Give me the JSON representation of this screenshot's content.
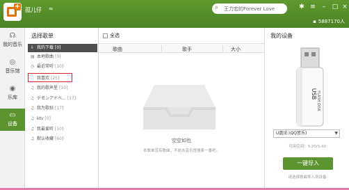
{
  "app": {
    "username": "孤儿仔",
    "search_placeholder": "王力宏的Forever Love",
    "online_count": "5887170人",
    "colors": {
      "brand_green": "#4a8323",
      "active_green": "#5c9430",
      "highlight_red": "#d9262c",
      "logo_orange": "#e57200"
    }
  },
  "nav": {
    "items": [
      {
        "label": "我的音乐",
        "icon": "headphones-icon"
      },
      {
        "label": "音乐馆",
        "icon": "music-hall-icon"
      },
      {
        "label": "乐库",
        "icon": "disc-icon"
      },
      {
        "label": "设备",
        "icon": "device-icon"
      }
    ]
  },
  "playlist": {
    "title": "选择歌单",
    "items": [
      {
        "label": "我的下载",
        "count": "[0]",
        "icon": "download-icon"
      },
      {
        "label": "本地歌曲",
        "count": "[0]",
        "icon": "local-music-icon"
      },
      {
        "label": "最近常听",
        "count": "[10]",
        "icon": "clock-icon"
      },
      {
        "label": "我喜欢",
        "count": "[25]",
        "icon": "heart-icon"
      },
      {
        "label": "我的歌声里",
        "count": "[10]",
        "icon": "playlist-icon"
      },
      {
        "label": "デモンアドベ...",
        "count": "[17]",
        "icon": "playlist-icon"
      },
      {
        "label": "我为歌狂",
        "count": "[17]",
        "icon": "playlist-icon"
      },
      {
        "label": "ktv",
        "count": "[0]",
        "icon": "playlist-icon"
      },
      {
        "label": "我最爱听",
        "count": "[10]",
        "icon": "playlist-icon"
      },
      {
        "label": "默认收藏",
        "count": "[60]",
        "icon": "playlist-icon"
      }
    ]
  },
  "main": {
    "select_all": "全选",
    "columns": [
      "歌曲",
      "歌手",
      "大小"
    ],
    "empty_title": "空空如也",
    "empty_sub": "本歌单没有歌曲，不妨去音乐馆搜索一番吧。"
  },
  "device": {
    "title": "我的设备",
    "usb_label": "USB",
    "usb_sub": "FLASH DISK",
    "selected_device": "U盘(E:\\QQ音乐)",
    "space": "可用空间：3.20/3.40",
    "import_button": "一键导入",
    "import_hint": "请选择歌曲导入到设备"
  }
}
